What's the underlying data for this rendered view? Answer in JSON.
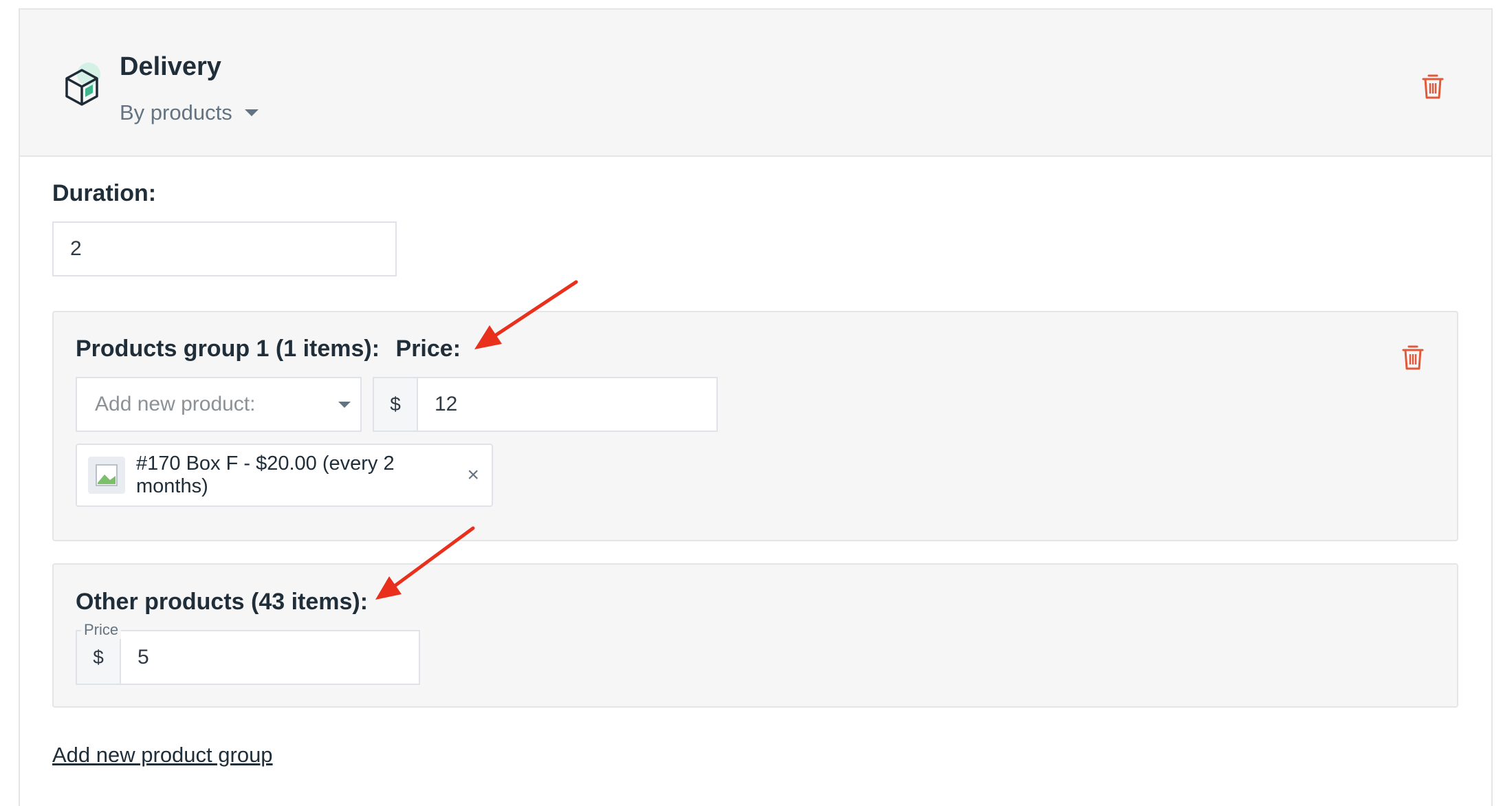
{
  "header": {
    "title": "Delivery",
    "mode": "By products"
  },
  "duration": {
    "label": "Duration:",
    "value": "2"
  },
  "group1": {
    "title": "Products group 1 (1 items):",
    "price_label": "Price:",
    "add_product_placeholder": "Add new product:",
    "currency": "$",
    "price_value": "12",
    "product_tag": "#170 Box F - $20.00 (every 2 months)",
    "tag_remove": "×"
  },
  "other": {
    "title": "Other products (43 items):",
    "price_field_label": "Price",
    "currency": "$",
    "price_value": "5"
  },
  "footer": {
    "add_group_link": "Add new product group"
  },
  "colors": {
    "trash": "#de5a3a",
    "annotation_arrow": "#e8301c",
    "icon_accent": "#3fb68b"
  },
  "icons": [
    "box-icon",
    "trash-icon",
    "caret-down-icon",
    "image-placeholder-icon",
    "close-icon",
    "arrow-annotation"
  ]
}
